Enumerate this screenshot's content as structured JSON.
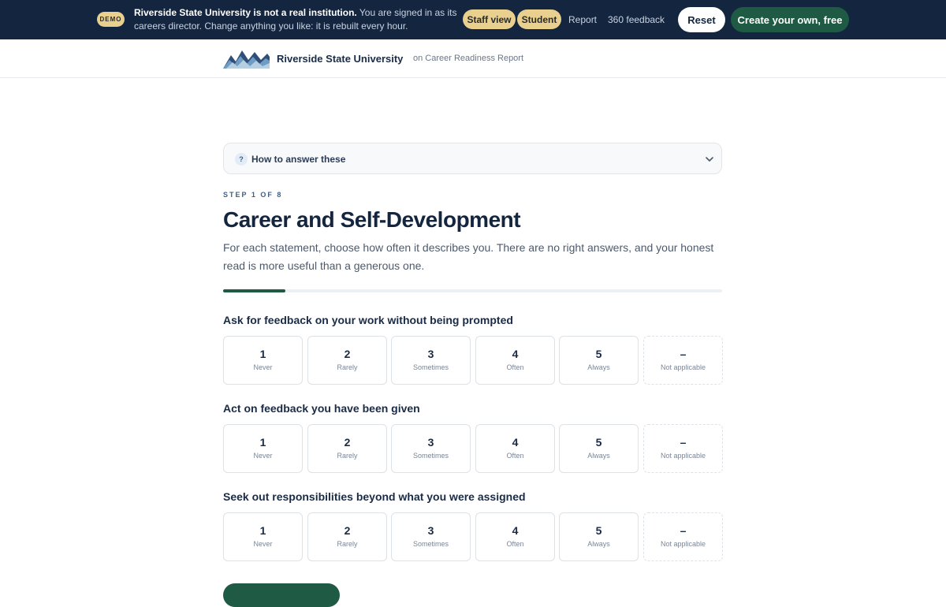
{
  "banner": {
    "demo_badge": "DEMO",
    "notice_bold": "Riverside State University is not a real institution.",
    "notice_rest": " You are signed in as its careers director. Change anything you like: it is rebuilt every hour.",
    "staff_view": "Staff view",
    "student": "Student",
    "report": "Report",
    "feedback_360": "360 feedback",
    "reset": "Reset",
    "create": "Create your own, free"
  },
  "header": {
    "university": "Riverside State University",
    "subtitle": "on Career Readiness Report"
  },
  "help": {
    "icon": "?",
    "label": "How to answer these"
  },
  "step": "STEP 1 OF 8",
  "title": "Career and Self-Development",
  "intro": "For each statement, choose how often it describes you. There are no right answers, and your honest read is more useful than a generous one.",
  "progress": 0.125,
  "scale": [
    {
      "num": "1",
      "label": "Never"
    },
    {
      "num": "2",
      "label": "Rarely"
    },
    {
      "num": "3",
      "label": "Sometimes"
    },
    {
      "num": "4",
      "label": "Often"
    },
    {
      "num": "5",
      "label": "Always"
    },
    {
      "num": "–",
      "label": "Not applicable"
    }
  ],
  "questions": [
    "Ask for feedback on your work without being prompted",
    "Act on feedback you have been given",
    "Seek out responsibilities beyond what you were assigned"
  ],
  "colors": {
    "navy": "#14253f",
    "accent_green": "#1f5a45",
    "demo_gold": "#e9d08e"
  }
}
